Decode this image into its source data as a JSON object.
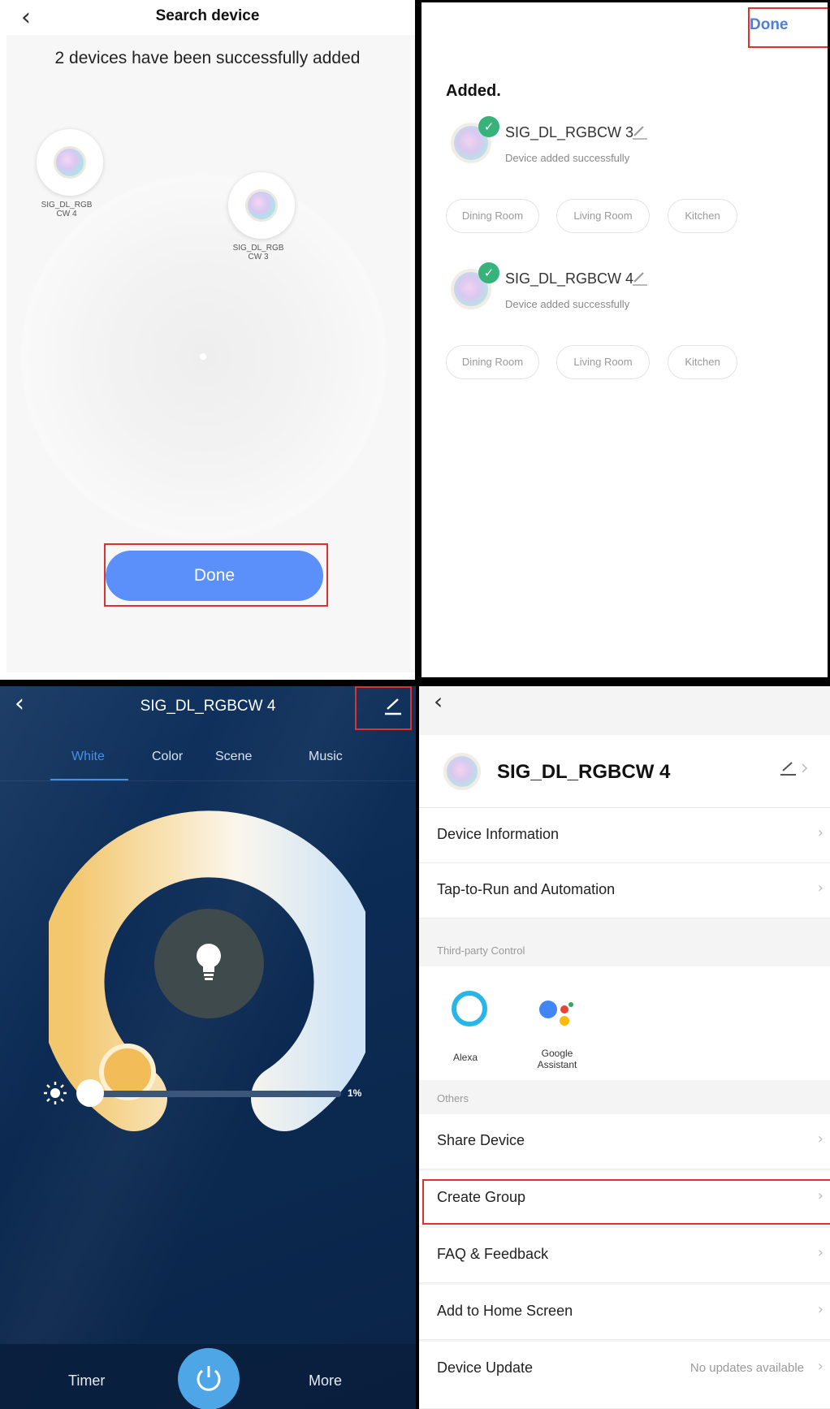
{
  "panel1": {
    "title": "Search device",
    "message": "2 devices have been successfully added",
    "devices": [
      {
        "label": "SIG_DL_RGB\nCW 4"
      },
      {
        "label": "SIG_DL_RGB\nCW 3"
      }
    ],
    "done_label": "Done"
  },
  "panel2": {
    "done_label": "Done",
    "heading": "Added.",
    "devices": [
      {
        "name": "SIG_DL_RGBCW 3",
        "status": "Device added successfully"
      },
      {
        "name": "SIG_DL_RGBCW 4",
        "status": "Device added successfully"
      }
    ],
    "rooms": [
      "Dining Room",
      "Living Room",
      "Kitchen"
    ]
  },
  "panel3": {
    "title": "SIG_DL_RGBCW 4",
    "tabs": [
      "White",
      "Color",
      "Scene",
      "Music"
    ],
    "active_tab": "White",
    "brightness": "1%",
    "timer_label": "Timer",
    "more_label": "More"
  },
  "panel4": {
    "device_name": "SIG_DL_RGBCW 4",
    "rows_top": [
      "Device Information",
      "Tap-to-Run and Automation"
    ],
    "third_party_section": "Third-party Control",
    "alexa_label": "Alexa",
    "google_label": "Google\nAssistant",
    "others_section": "Others",
    "rows_others": [
      "Share Device",
      "Create Group",
      "FAQ & Feedback",
      "Add to Home Screen",
      "Device Update"
    ],
    "update_value": "No updates available"
  },
  "colors": {
    "primary_blue": "#5b8ff9",
    "highlight_red": "#e0312f",
    "check_green": "#36b27a",
    "control_bg": "#0c2b54",
    "tab_active": "#4a8fe4"
  }
}
